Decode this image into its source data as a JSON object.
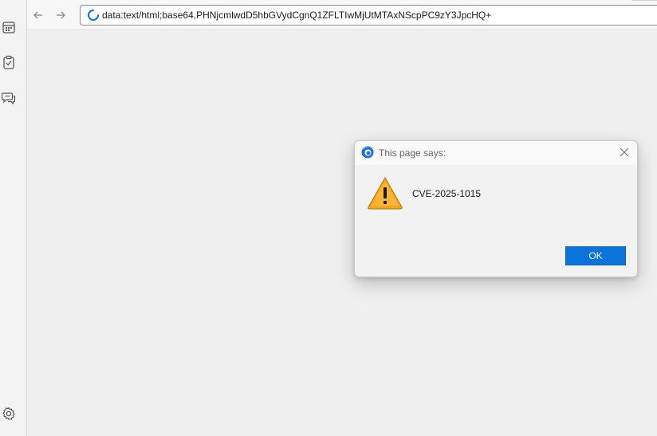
{
  "browser": {
    "address_url": "data:text/html;base64,PHNjcmlwdD5hbGVydCgnQ1ZFLTIwMjUtMTAxNScpPC9zY3JpcHQ+",
    "back_icon": "arrow-left-icon",
    "forward_icon": "arrow-right-icon",
    "loading_icon": "loading-spinner-icon"
  },
  "sidebar": {
    "items": [
      {
        "icon": "calendar-icon"
      },
      {
        "icon": "clipboard-check-icon"
      },
      {
        "icon": "chat-bubbles-icon"
      }
    ],
    "settings_icon": "gear-icon"
  },
  "dialog": {
    "title": "This page says:",
    "message": "CVE-2025-1015",
    "ok_label": "OK",
    "accent": "#0a74da",
    "warning_color": "#f5a623"
  }
}
